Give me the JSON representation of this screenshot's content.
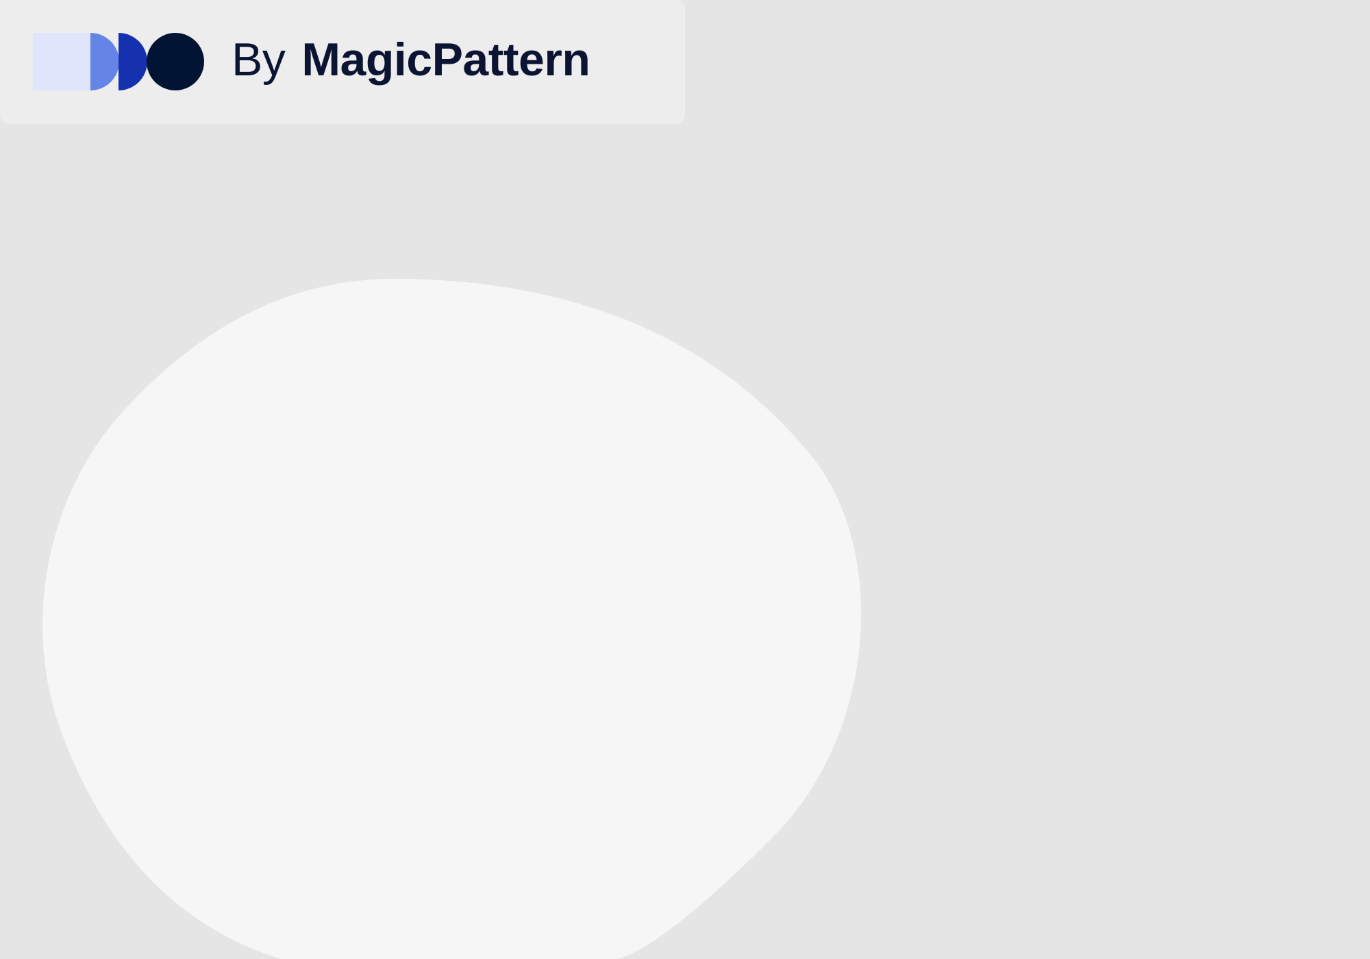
{
  "header": {
    "by_label": "By",
    "brand_name": "MagicPattern",
    "logo": {
      "icon": "magicpattern-logo-icon",
      "colors": {
        "pale": "#e0e5fc",
        "mid": "#6585e6",
        "royal": "#1531ae",
        "navy": "#021433"
      }
    }
  },
  "colors": {
    "background": "#e5e5e5",
    "header_card": "#ededed",
    "blob": "#f6f6f6",
    "text": "#0b1533"
  }
}
